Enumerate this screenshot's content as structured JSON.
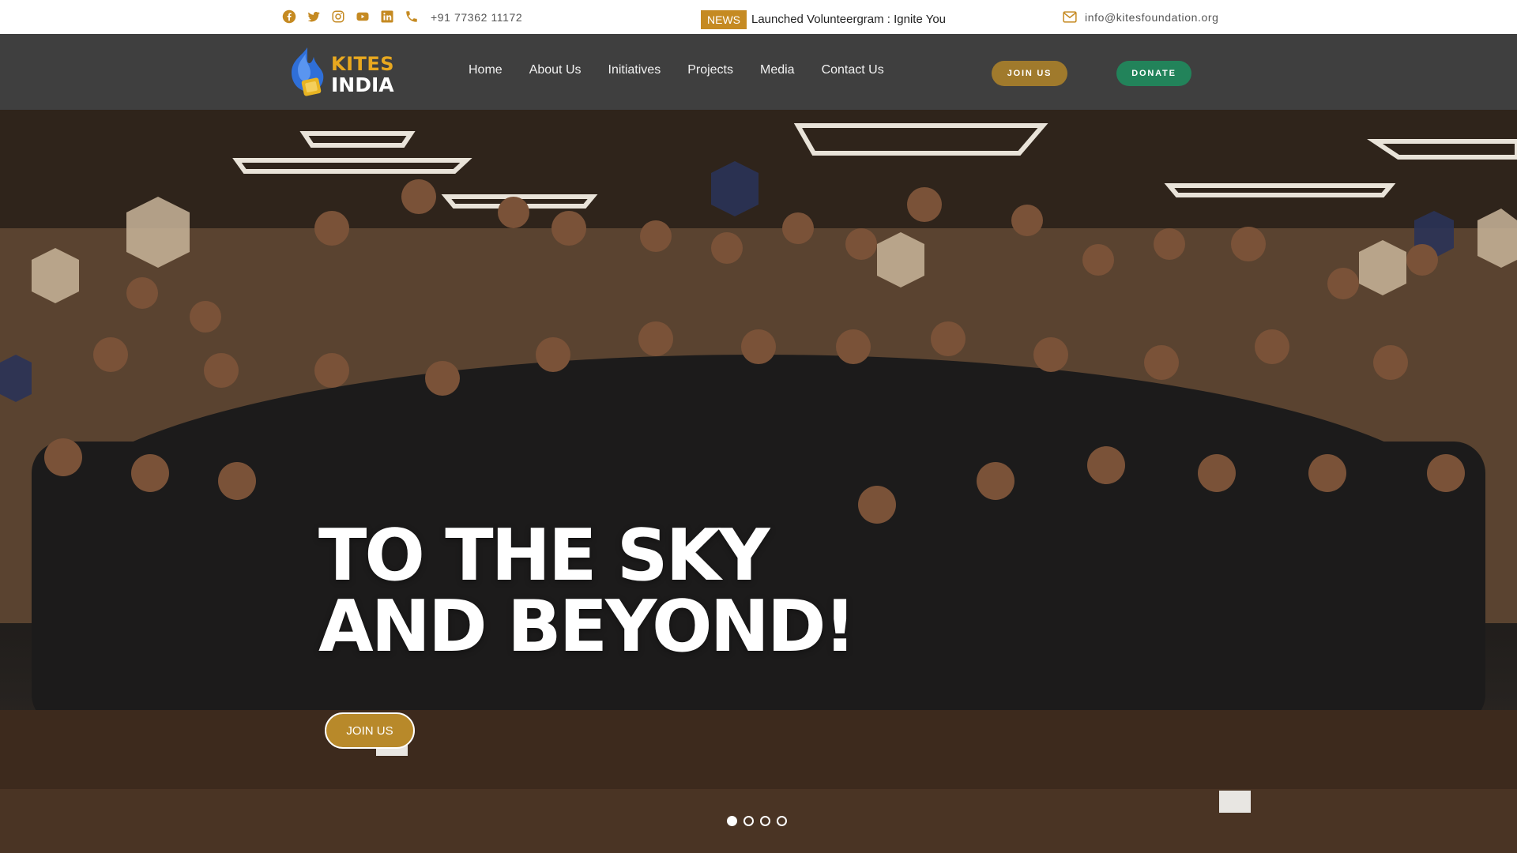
{
  "topbar": {
    "socials": [
      {
        "icon": "facebook-icon"
      },
      {
        "icon": "twitter-icon"
      },
      {
        "icon": "instagram-icon"
      },
      {
        "icon": "youtube-icon"
      },
      {
        "icon": "linkedin-icon"
      },
      {
        "icon": "phone-icon"
      }
    ],
    "phone": "+91 77362 11172",
    "news_badge": "NEWS",
    "news_text": "Launched Volunteergram : Ignite You",
    "email": "info@kitesfoundation.org",
    "accent": "#c58a22"
  },
  "nav": {
    "logo_line1": "KITES",
    "logo_line2": "INDIA",
    "items": [
      "Home",
      "About Us",
      "Initiatives",
      "Projects",
      "Media",
      "Contact Us"
    ],
    "join_label": "JOIN US",
    "donate_label": "DONATE",
    "join_color": "#a07a2c",
    "donate_color": "#22835a"
  },
  "hero": {
    "title_line1": "TO THE SKY",
    "title_line2": "AND BEYOND!",
    "button_label": "JOIN US",
    "slides": 4,
    "active_slide": 1
  }
}
